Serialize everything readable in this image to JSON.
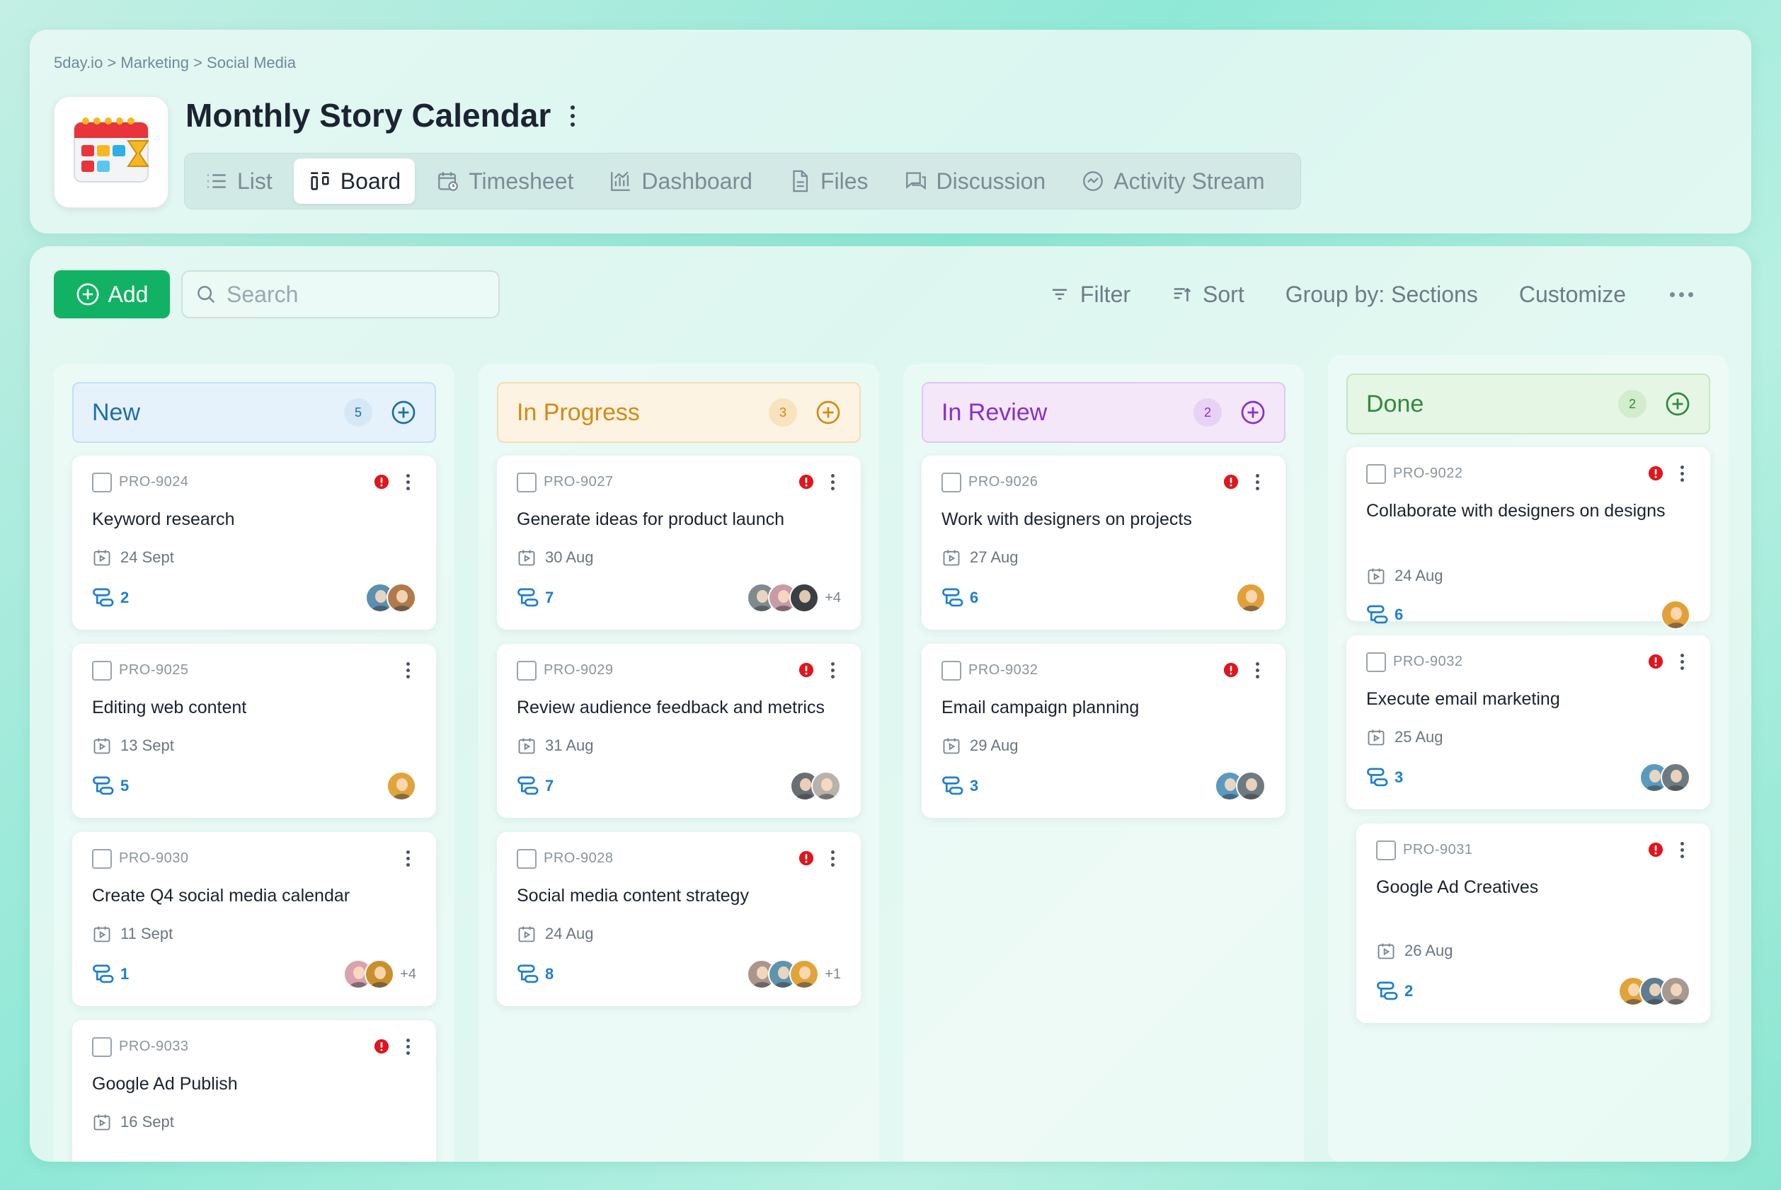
{
  "breadcrumb": "5day.io > Marketing > Social Media",
  "page_title": "Monthly Story Calendar",
  "tabs": [
    {
      "label": "List",
      "icon": "list-icon",
      "active": false
    },
    {
      "label": "Board",
      "icon": "board-icon",
      "active": true
    },
    {
      "label": "Timesheet",
      "icon": "timesheet-icon",
      "active": false
    },
    {
      "label": "Dashboard",
      "icon": "dashboard-icon",
      "active": false
    },
    {
      "label": "Files",
      "icon": "file-icon",
      "active": false
    },
    {
      "label": "Discussion",
      "icon": "discussion-icon",
      "active": false
    },
    {
      "label": "Activity Stream",
      "icon": "activity-icon",
      "active": false
    }
  ],
  "toolbar": {
    "add_label": "Add",
    "search_placeholder": "Search",
    "filter_label": "Filter",
    "sort_label": "Sort",
    "group_label": "Group by: Sections",
    "customize_label": "Customize"
  },
  "colors": {
    "accent_green": "#12b264",
    "alert_red": "#e0161e",
    "subtask_blue": "#1f7fd0"
  },
  "columns": [
    {
      "title": "New",
      "count": "5",
      "color": "#1f6ea8",
      "header_bg": "#e6f2fb",
      "header_border": "#c5def3",
      "count_bg": "#d6e8f6",
      "cards": [
        {
          "id": "PRO-9024",
          "title": "Keyword research",
          "date": "24 Sept",
          "subtasks": "2",
          "alert": true,
          "avatars": [
            "#5a8fb0",
            "#b07a4a"
          ],
          "more": ""
        },
        {
          "id": "PRO-9025",
          "title": "Editing web content",
          "date": "13 Sept",
          "subtasks": "5",
          "alert": false,
          "avatars": [
            "#e0a43a"
          ],
          "more": ""
        },
        {
          "id": "PRO-9030",
          "title": "Create Q4 social media calendar",
          "date": "11 Sept",
          "subtasks": "1",
          "alert": false,
          "avatars": [
            "#d9a2ae",
            "#c98f2a"
          ],
          "more": "+4"
        },
        {
          "id": "PRO-9033",
          "title": "Google Ad Publish",
          "date": "16 Sept",
          "subtasks": "",
          "alert": true,
          "avatars": [],
          "more": ""
        }
      ]
    },
    {
      "title": "In Progress",
      "count": "3",
      "color": "#d48a14",
      "header_bg": "#fdf3e2",
      "header_border": "#f3ddb5",
      "count_bg": "#f7e3bd",
      "cards": [
        {
          "id": "PRO-9027",
          "title": "Generate ideas for product launch",
          "date": "30 Aug",
          "subtasks": "7",
          "alert": true,
          "avatars": [
            "#7e8a8e",
            "#c99aa8",
            "#3a3f44"
          ],
          "more": "+4"
        },
        {
          "id": "PRO-9029",
          "title": "Review audience feedback and metrics",
          "date": "31 Aug",
          "subtasks": "7",
          "alert": true,
          "avatars": [
            "#6a6f74",
            "#b9b2ab"
          ],
          "more": ""
        },
        {
          "id": "PRO-9028",
          "title": "Social media content strategy",
          "date": "24 Aug",
          "subtasks": "8",
          "alert": true,
          "avatars": [
            "#a8978a",
            "#5f93ae",
            "#e0a43a"
          ],
          "more": "+1"
        }
      ]
    },
    {
      "title": "In Review",
      "count": "2",
      "color": "#8a2fc9",
      "header_bg": "#f4e7fa",
      "header_border": "#e3c7f1",
      "count_bg": "#e8d2f5",
      "cards": [
        {
          "id": "PRO-9026",
          "title": "Work with designers on projects",
          "date": "27 Aug",
          "subtasks": "6",
          "alert": true,
          "avatars": [
            "#e2a039"
          ],
          "more": ""
        },
        {
          "id": "PRO-9032",
          "title": "Email campaign planning",
          "date": "29 Aug",
          "subtasks": "3",
          "alert": true,
          "avatars": [
            "#5a9bbd",
            "#6d7a82"
          ],
          "more": ""
        }
      ]
    },
    {
      "title": "Done",
      "count": "2",
      "color": "#2f8a3e",
      "header_bg": "#e6f6e4",
      "header_border": "#c6e7c3",
      "count_bg": "#d2eccd",
      "cards": [
        {
          "id": "PRO-9022",
          "title": "Collaborate with designers on designs",
          "date": "24 Aug",
          "subtasks": "6",
          "alert": true,
          "avatars": [
            "#e2a039"
          ],
          "more": ""
        },
        {
          "id": "PRO-9032",
          "title": "Execute email marketing",
          "date": "25 Aug",
          "subtasks": "3",
          "alert": true,
          "avatars": [
            "#5a9bbd",
            "#6d7a82"
          ],
          "more": ""
        },
        {
          "id": "PRO-9031",
          "title": "Google Ad Creatives",
          "date": "26 Aug",
          "subtasks": "2",
          "alert": true,
          "avatars": [
            "#e0a43a",
            "#5f7d8e",
            "#a89a90"
          ],
          "more": ""
        }
      ]
    }
  ]
}
